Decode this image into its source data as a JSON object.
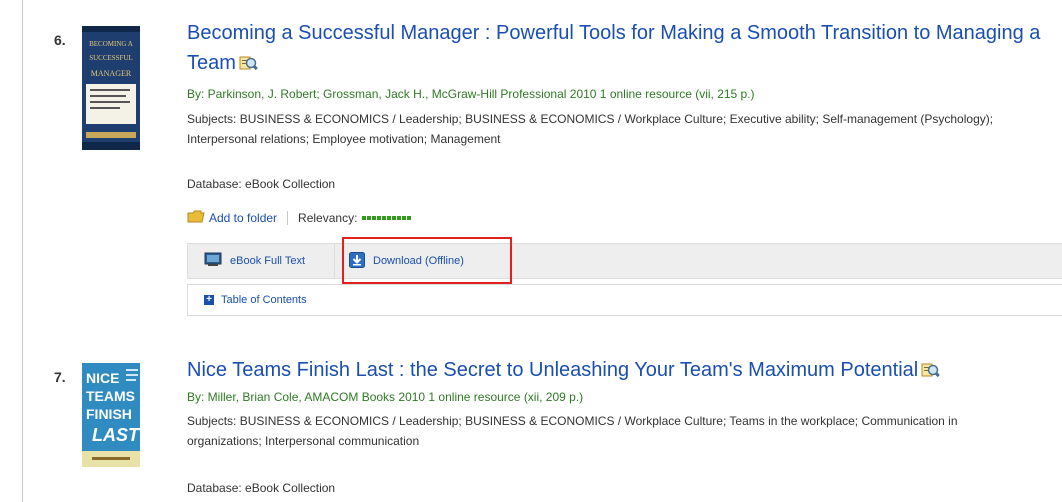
{
  "results": [
    {
      "number": "6.",
      "title": "Becoming a Successful Manager : Powerful Tools for Making a Smooth Transition to Managing a Team",
      "byline": "By: Parkinson, J. Robert; Grossman, Jack H., McGraw-Hill Professional 2010 1 online resource (vii, 215 p.)",
      "subjects": "Subjects: BUSINESS & ECONOMICS / Leadership; BUSINESS & ECONOMICS / Workplace Culture; Executive ability; Self-management (Psychology); Interpersonal relations; Employee motivation; Management",
      "database": "Database: eBook Collection",
      "add_to_folder": "Add to folder",
      "relevancy_label": "Relevancy:",
      "tabs": {
        "fulltext": "eBook Full Text",
        "download": "Download (Offline)"
      },
      "toc": "Table of Contents",
      "cover": {
        "line1": "BECOMING A",
        "line2": "SUCCESSFUL",
        "line3": "MANAGER",
        "color_bg": "#1d3e6e",
        "color_text": "#e8c876"
      }
    },
    {
      "number": "7.",
      "title": "Nice Teams Finish Last : the Secret to Unleashing Your Team's Maximum Potential",
      "byline": "By: Miller, Brian Cole, AMACOM Books 2010 1 online resource (xii, 209 p.)",
      "subjects": "Subjects: BUSINESS & ECONOMICS / Leadership; BUSINESS & ECONOMICS / Workplace Culture; Teams in the workplace; Communication in organizations; Interpersonal communication",
      "database": "Database: eBook Collection",
      "cover": {
        "line1": "NICE",
        "line2": "TEAMS",
        "line3": "FINISH",
        "line4": "LAST",
        "color_bg": "#2f8bc0",
        "color_text": "#ffffff"
      }
    }
  ],
  "colors": {
    "link": "#1a4fb0",
    "byline": "#2f7a24",
    "highlight": "#e0211e",
    "relevancy": "#2f9a1e"
  },
  "icons": {
    "preview": "magnifier-preview-icon",
    "folder": "folder-icon",
    "fulltext": "ebook-fulltext-icon",
    "download": "download-arrow-icon",
    "toc": "plus-icon"
  }
}
